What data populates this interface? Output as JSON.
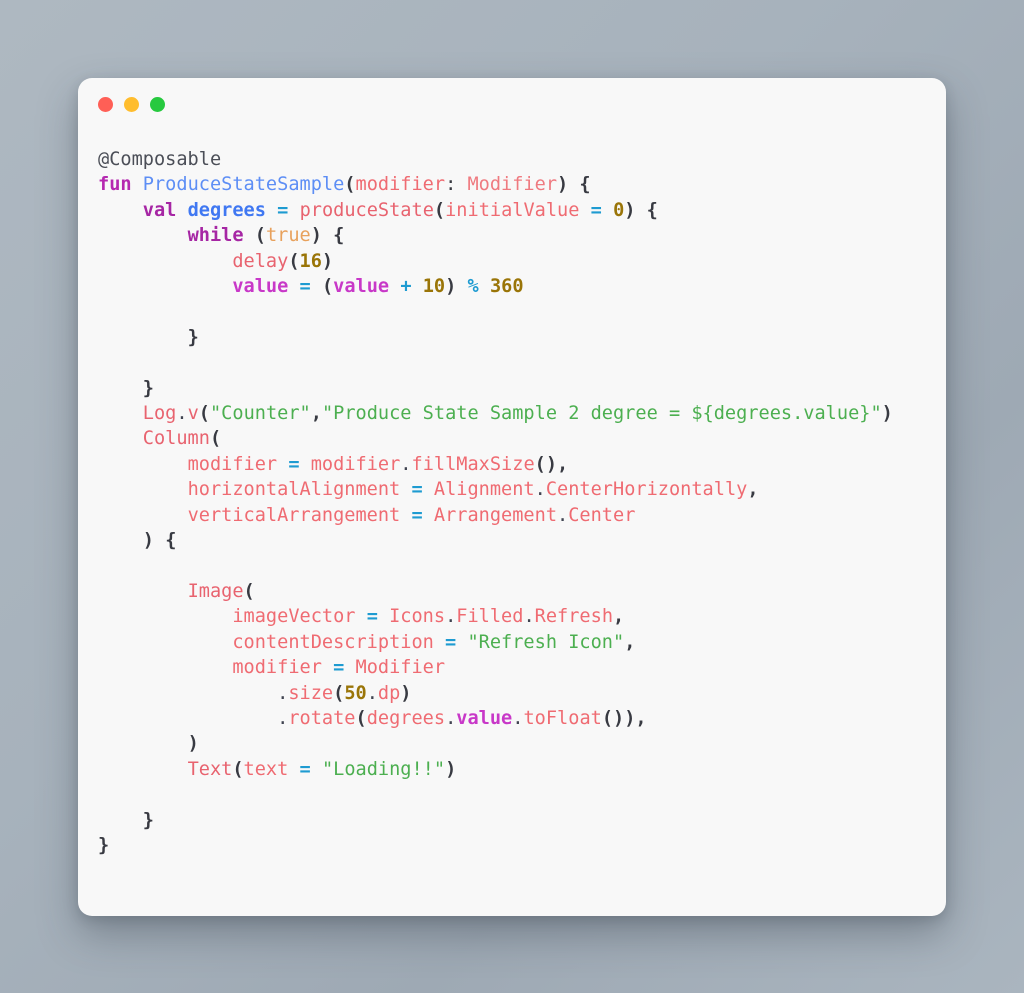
{
  "window": {
    "background_color": "#a7b2bc",
    "card_color": "#f8f8f8",
    "traffic_lights": [
      {
        "name": "close",
        "color": "#ff5f56"
      },
      {
        "name": "minimize",
        "color": "#ffbd2e"
      },
      {
        "name": "maximize",
        "color": "#27c93f"
      }
    ]
  },
  "code": {
    "language": "kotlin",
    "full_text": "@Composable\nfun ProduceStateSample(modifier: Modifier) {\n    val degrees = produceState(initialValue = 0) {\n        while (true) {\n            delay(16)\n            value = (value + 10) % 360\n\n        }\n\n    }\n    Log.v(\"Counter\",\"Produce State Sample 2 degree = ${degrees.value}\")\n    Column(\n        modifier = modifier.fillMaxSize(),\n        horizontalAlignment = Alignment.CenterHorizontally,\n        verticalArrangement = Arrangement.Center\n    ) {\n\n        Image(\n            imageVector = Icons.Filled.Refresh,\n            contentDescription = \"Refresh Icon\",\n            modifier = Modifier\n                .size(50.dp)\n                .rotate(degrees.value.toFloat()),\n        )\n        Text(text = \"Loading!!\")\n\n    }\n}",
    "lines": [
      {
        "id": "l1",
        "tokens": [
          {
            "c": "t-anno",
            "t": "@Composable"
          }
        ]
      },
      {
        "id": "l2",
        "tokens": [
          {
            "c": "t-kw",
            "t": "fun"
          },
          {
            "c": "t-plain",
            "t": " "
          },
          {
            "c": "t-fn",
            "t": "ProduceStateSample"
          },
          {
            "c": "t-punc",
            "t": "("
          },
          {
            "c": "t-ident",
            "t": "modifier"
          },
          {
            "c": "t-plain",
            "t": ": "
          },
          {
            "c": "t-type",
            "t": "Modifier"
          },
          {
            "c": "t-punc",
            "t": ")"
          },
          {
            "c": "t-plain",
            "t": " "
          },
          {
            "c": "t-punc",
            "t": "{"
          }
        ]
      },
      {
        "id": "l3",
        "tokens": [
          {
            "c": "t-plain",
            "t": "    "
          },
          {
            "c": "t-kw2",
            "t": "val"
          },
          {
            "c": "t-plain",
            "t": " "
          },
          {
            "c": "t-var",
            "t": "degrees"
          },
          {
            "c": "t-plain",
            "t": " "
          },
          {
            "c": "t-op",
            "t": "="
          },
          {
            "c": "t-plain",
            "t": " "
          },
          {
            "c": "t-call",
            "t": "produceState"
          },
          {
            "c": "t-punc",
            "t": "("
          },
          {
            "c": "t-ident",
            "t": "initialValue"
          },
          {
            "c": "t-plain",
            "t": " "
          },
          {
            "c": "t-op",
            "t": "="
          },
          {
            "c": "t-plain",
            "t": " "
          },
          {
            "c": "t-num",
            "t": "0"
          },
          {
            "c": "t-punc",
            "t": ")"
          },
          {
            "c": "t-plain",
            "t": " "
          },
          {
            "c": "t-punc",
            "t": "{"
          }
        ]
      },
      {
        "id": "l4",
        "tokens": [
          {
            "c": "t-plain",
            "t": "        "
          },
          {
            "c": "t-kw2",
            "t": "while"
          },
          {
            "c": "t-plain",
            "t": " "
          },
          {
            "c": "t-punc",
            "t": "("
          },
          {
            "c": "t-bool",
            "t": "true"
          },
          {
            "c": "t-punc",
            "t": ")"
          },
          {
            "c": "t-plain",
            "t": " "
          },
          {
            "c": "t-punc",
            "t": "{"
          }
        ]
      },
      {
        "id": "l5",
        "tokens": [
          {
            "c": "t-plain",
            "t": "            "
          },
          {
            "c": "t-call",
            "t": "delay"
          },
          {
            "c": "t-punc",
            "t": "("
          },
          {
            "c": "t-num",
            "t": "16"
          },
          {
            "c": "t-punc",
            "t": ")"
          }
        ]
      },
      {
        "id": "l6",
        "tokens": [
          {
            "c": "t-plain",
            "t": "            "
          },
          {
            "c": "t-prop",
            "t": "value"
          },
          {
            "c": "t-plain",
            "t": " "
          },
          {
            "c": "t-op",
            "t": "="
          },
          {
            "c": "t-plain",
            "t": " "
          },
          {
            "c": "t-punc",
            "t": "("
          },
          {
            "c": "t-prop",
            "t": "value"
          },
          {
            "c": "t-plain",
            "t": " "
          },
          {
            "c": "t-op",
            "t": "+"
          },
          {
            "c": "t-plain",
            "t": " "
          },
          {
            "c": "t-num",
            "t": "10"
          },
          {
            "c": "t-punc",
            "t": ")"
          },
          {
            "c": "t-plain",
            "t": " "
          },
          {
            "c": "t-op",
            "t": "%"
          },
          {
            "c": "t-plain",
            "t": " "
          },
          {
            "c": "t-num",
            "t": "360"
          }
        ]
      },
      {
        "id": "l7",
        "tokens": [
          {
            "c": "t-plain",
            "t": ""
          }
        ]
      },
      {
        "id": "l8",
        "tokens": [
          {
            "c": "t-plain",
            "t": "        "
          },
          {
            "c": "t-punc",
            "t": "}"
          }
        ]
      },
      {
        "id": "l9",
        "tokens": [
          {
            "c": "t-plain",
            "t": ""
          }
        ]
      },
      {
        "id": "l10",
        "tokens": [
          {
            "c": "t-plain",
            "t": "    "
          },
          {
            "c": "t-punc",
            "t": "}"
          }
        ]
      },
      {
        "id": "l11",
        "tokens": [
          {
            "c": "t-plain",
            "t": "    "
          },
          {
            "c": "t-call",
            "t": "Log"
          },
          {
            "c": "t-dot",
            "t": "."
          },
          {
            "c": "t-call",
            "t": "v"
          },
          {
            "c": "t-punc",
            "t": "("
          },
          {
            "c": "t-str",
            "t": "\"Counter\""
          },
          {
            "c": "t-punc",
            "t": ","
          },
          {
            "c": "t-str",
            "t": "\"Produce State Sample 2 degree = ${degrees.value}\""
          },
          {
            "c": "t-punc",
            "t": ")"
          }
        ]
      },
      {
        "id": "l12",
        "tokens": [
          {
            "c": "t-plain",
            "t": "    "
          },
          {
            "c": "t-call",
            "t": "Column"
          },
          {
            "c": "t-punc",
            "t": "("
          }
        ]
      },
      {
        "id": "l13",
        "tokens": [
          {
            "c": "t-plain",
            "t": "        "
          },
          {
            "c": "t-ident",
            "t": "modifier"
          },
          {
            "c": "t-plain",
            "t": " "
          },
          {
            "c": "t-op",
            "t": "="
          },
          {
            "c": "t-plain",
            "t": " "
          },
          {
            "c": "t-ident",
            "t": "modifier"
          },
          {
            "c": "t-dot",
            "t": "."
          },
          {
            "c": "t-ident",
            "t": "fillMaxSize"
          },
          {
            "c": "t-punc",
            "t": "(),"
          }
        ]
      },
      {
        "id": "l14",
        "tokens": [
          {
            "c": "t-plain",
            "t": "        "
          },
          {
            "c": "t-ident",
            "t": "horizontalAlignment"
          },
          {
            "c": "t-plain",
            "t": " "
          },
          {
            "c": "t-op",
            "t": "="
          },
          {
            "c": "t-plain",
            "t": " "
          },
          {
            "c": "t-ident",
            "t": "Alignment"
          },
          {
            "c": "t-dot",
            "t": "."
          },
          {
            "c": "t-ident",
            "t": "CenterHorizontally"
          },
          {
            "c": "t-punc",
            "t": ","
          }
        ]
      },
      {
        "id": "l15",
        "tokens": [
          {
            "c": "t-plain",
            "t": "        "
          },
          {
            "c": "t-ident",
            "t": "verticalArrangement"
          },
          {
            "c": "t-plain",
            "t": " "
          },
          {
            "c": "t-op",
            "t": "="
          },
          {
            "c": "t-plain",
            "t": " "
          },
          {
            "c": "t-ident",
            "t": "Arrangement"
          },
          {
            "c": "t-dot",
            "t": "."
          },
          {
            "c": "t-ident",
            "t": "Center"
          }
        ]
      },
      {
        "id": "l16",
        "tokens": [
          {
            "c": "t-plain",
            "t": "    "
          },
          {
            "c": "t-punc",
            "t": ")"
          },
          {
            "c": "t-plain",
            "t": " "
          },
          {
            "c": "t-punc",
            "t": "{"
          }
        ]
      },
      {
        "id": "l17",
        "tokens": [
          {
            "c": "t-plain",
            "t": ""
          }
        ]
      },
      {
        "id": "l18",
        "tokens": [
          {
            "c": "t-plain",
            "t": "        "
          },
          {
            "c": "t-call",
            "t": "Image"
          },
          {
            "c": "t-punc",
            "t": "("
          }
        ]
      },
      {
        "id": "l19",
        "tokens": [
          {
            "c": "t-plain",
            "t": "            "
          },
          {
            "c": "t-ident",
            "t": "imageVector"
          },
          {
            "c": "t-plain",
            "t": " "
          },
          {
            "c": "t-op",
            "t": "="
          },
          {
            "c": "t-plain",
            "t": " "
          },
          {
            "c": "t-ident",
            "t": "Icons"
          },
          {
            "c": "t-dot",
            "t": "."
          },
          {
            "c": "t-ident",
            "t": "Filled"
          },
          {
            "c": "t-dot",
            "t": "."
          },
          {
            "c": "t-ident",
            "t": "Refresh"
          },
          {
            "c": "t-punc",
            "t": ","
          }
        ]
      },
      {
        "id": "l20",
        "tokens": [
          {
            "c": "t-plain",
            "t": "            "
          },
          {
            "c": "t-ident",
            "t": "contentDescription"
          },
          {
            "c": "t-plain",
            "t": " "
          },
          {
            "c": "t-op",
            "t": "="
          },
          {
            "c": "t-plain",
            "t": " "
          },
          {
            "c": "t-str",
            "t": "\"Refresh Icon\""
          },
          {
            "c": "t-punc",
            "t": ","
          }
        ]
      },
      {
        "id": "l21",
        "tokens": [
          {
            "c": "t-plain",
            "t": "            "
          },
          {
            "c": "t-ident",
            "t": "modifier"
          },
          {
            "c": "t-plain",
            "t": " "
          },
          {
            "c": "t-op",
            "t": "="
          },
          {
            "c": "t-plain",
            "t": " "
          },
          {
            "c": "t-ident",
            "t": "Modifier"
          }
        ]
      },
      {
        "id": "l22",
        "tokens": [
          {
            "c": "t-plain",
            "t": "                "
          },
          {
            "c": "t-dot",
            "t": "."
          },
          {
            "c": "t-ident",
            "t": "size"
          },
          {
            "c": "t-punc",
            "t": "("
          },
          {
            "c": "t-num",
            "t": "50"
          },
          {
            "c": "t-dot",
            "t": "."
          },
          {
            "c": "t-ident",
            "t": "dp"
          },
          {
            "c": "t-punc",
            "t": ")"
          }
        ]
      },
      {
        "id": "l23",
        "tokens": [
          {
            "c": "t-plain",
            "t": "                "
          },
          {
            "c": "t-dot",
            "t": "."
          },
          {
            "c": "t-ident",
            "t": "rotate"
          },
          {
            "c": "t-punc",
            "t": "("
          },
          {
            "c": "t-ident",
            "t": "degrees"
          },
          {
            "c": "t-dot",
            "t": "."
          },
          {
            "c": "t-prop",
            "t": "value"
          },
          {
            "c": "t-dot",
            "t": "."
          },
          {
            "c": "t-ident",
            "t": "toFloat"
          },
          {
            "c": "t-punc",
            "t": "()),"
          }
        ]
      },
      {
        "id": "l24",
        "tokens": [
          {
            "c": "t-plain",
            "t": "        "
          },
          {
            "c": "t-punc",
            "t": ")"
          }
        ]
      },
      {
        "id": "l25",
        "tokens": [
          {
            "c": "t-plain",
            "t": "        "
          },
          {
            "c": "t-call",
            "t": "Text"
          },
          {
            "c": "t-punc",
            "t": "("
          },
          {
            "c": "t-ident",
            "t": "text"
          },
          {
            "c": "t-plain",
            "t": " "
          },
          {
            "c": "t-op",
            "t": "="
          },
          {
            "c": "t-plain",
            "t": " "
          },
          {
            "c": "t-str",
            "t": "\"Loading!!\""
          },
          {
            "c": "t-punc",
            "t": ")"
          }
        ]
      },
      {
        "id": "l26",
        "tokens": [
          {
            "c": "t-plain",
            "t": ""
          }
        ]
      },
      {
        "id": "l27",
        "tokens": [
          {
            "c": "t-plain",
            "t": "    "
          },
          {
            "c": "t-punc",
            "t": "}"
          }
        ]
      },
      {
        "id": "l28",
        "tokens": [
          {
            "c": "t-punc",
            "t": "}"
          }
        ]
      }
    ]
  }
}
